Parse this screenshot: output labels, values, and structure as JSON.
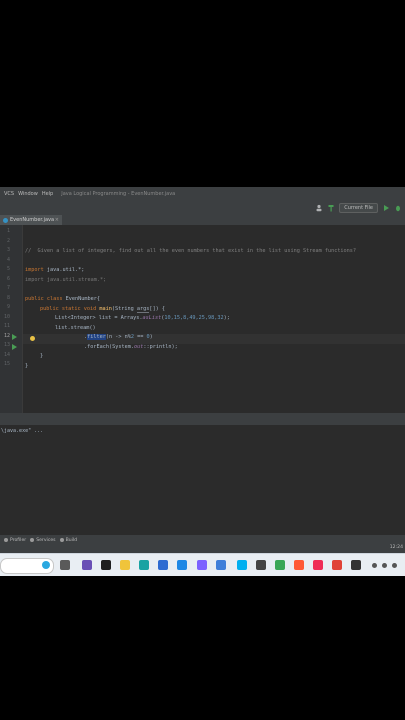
{
  "menubar": {
    "items": [
      "VCS",
      "Window",
      "Help"
    ],
    "title": "Java Logical Programming - EvenNumber.java"
  },
  "toolbar": {
    "run_config": "Current File"
  },
  "tab": {
    "name": "EvenNumber.java",
    "close": "×"
  },
  "editor": {
    "line_numbers": [
      "1",
      "2",
      "3",
      "4",
      "5",
      "6",
      "7",
      "8",
      "9",
      "10",
      "11",
      "12",
      "13",
      "14",
      "15"
    ],
    "current_line": "12",
    "comment": "//  Given a list of integers, find out all the even numbers that exist in the list using Stream functions?",
    "import1_kw": "import",
    "import1_rest": " java.util.*;",
    "import2": "import java.util.stream.*;",
    "class_kw": "public class",
    "class_name": " EvenNumber{",
    "main_kw": "public static void",
    "main_name": "main",
    "main_open": "(String ",
    "main_param": "args",
    "main_close": "[]) {",
    "list_decl": "List<Integer> list = Arrays.",
    "list_call": "asList",
    "list_open": "(",
    "list_nums": "10,15,8,49,25,98,32",
    "list_close": ");",
    "stream": "list.stream()",
    "filter_dot": ".",
    "filter_name": "filter",
    "filter_open": "(n -> n%",
    "filter_two": "2",
    "filter_eq": " == ",
    "filter_zero": "0",
    "filter_close": ")",
    "foreach_pre": ".forEach(System.",
    "foreach_out": "out",
    "foreach_post": "::println);",
    "brace1": "}",
    "brace2": "}"
  },
  "console": {
    "line": "\\java.exe\" ..."
  },
  "statusbar": {
    "profiler": "Profiler",
    "services": "Services",
    "build": "Build",
    "time": "12:24"
  },
  "colors": {
    "editor_bg": "#2b2b2b",
    "keyword": "#cc7832",
    "comment": "#808080",
    "number": "#6897bb",
    "method": "#ffc66d",
    "static_field": "#9876aa",
    "selection": "#214283"
  }
}
